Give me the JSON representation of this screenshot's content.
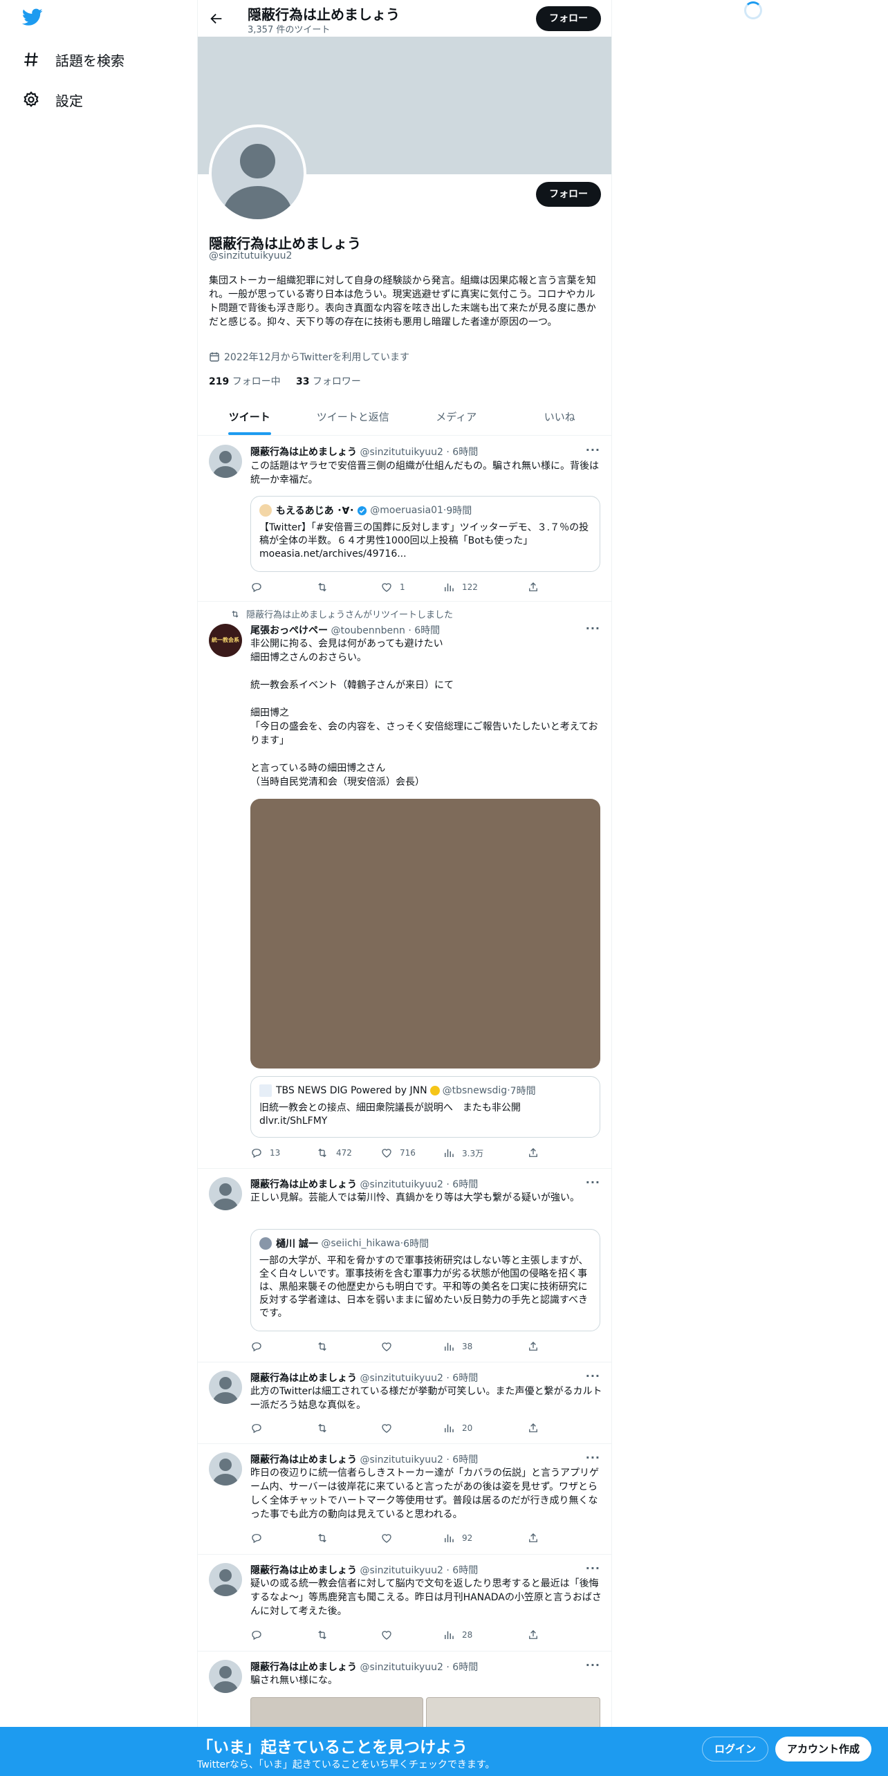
{
  "nav": {
    "search_label": "話題を検索",
    "settings_label": "設定",
    "logo": "twitter-bird-icon"
  },
  "header": {
    "title": "隠蔽行為は止めましょう",
    "tweet_count": "3,357 件のツイート",
    "follow_label": "フォロー"
  },
  "profile": {
    "name": "隠蔽行為は止めましょう",
    "handle": "@sinzitutuikyuu2",
    "bio": "集団ストーカー組織犯罪に対して自身の経験談から発言。組織は因果応報と言う言葉を知れ。一般が思っている寄り日本は危うい。現実逃避せずに真実に気付こう。コロナやカルト問題で背後も浮き彫り。表向き真面な内容を呟き出した末端も出て来たが見る度に愚かだと感じる。抑々、天下り等の存在に技術も悪用し暗躍した者達が原因の一つ。",
    "joined": "2022年12月からTwitterを利用しています",
    "following_count": "219",
    "following_label": "フォロー中",
    "followers_count": "33",
    "followers_label": "フォロワー",
    "follow_label": "フォロー"
  },
  "tabs": [
    "ツイート",
    "ツイートと返信",
    "メディア",
    "いいね"
  ],
  "tweets": [
    {
      "name": "隠蔽行為は止めましょう",
      "handle": "@sinzitutuikyuu2",
      "time": "6時間",
      "text": "この話題はヤラセで安倍晋三側の組織が仕組んだもの。騙され無い様に。背後は統一か幸福だ。",
      "quote": {
        "name": "もえるあじあ ･∀･",
        "handle": "@moeruasia01",
        "time": "9時間",
        "text": "【Twitter】「#安倍晋三の国葬に反対します」ツイッターデモ、３.７％の投稿が全体の半数。６４才男性1000回以上投稿「Botも使った」\nmoeasia.net/archives/49716..."
      },
      "stats": {
        "reply": "",
        "retweet": "",
        "like": "1",
        "views": "122"
      }
    },
    {
      "retweeted_by": "隠蔽行為は止めましょうさんがリツイートしました",
      "name": "尾張おっぺけペー",
      "handle": "@toubennbenn",
      "time": "6時間",
      "text": "非公開に拘る、会見は何があっても避けたい\n細田博之さんのおさらい。\n\n統一教会系イベント（韓鶴子さんが来日）にて\n\n細田博之\n「今日の盛会を、会の内容を、さっそく安倍総理にご報告いたしたいと考えております」\n\nと言っている時の細田博之さん\n（当時自民党清和会（現安倍派）会長）",
      "quote": {
        "name": "TBS NEWS DIG Powered by JNN",
        "handle": "@tbsnewsdig",
        "time": "7時間",
        "text": "旧統一教会との接点、細田衆院議長が説明へ　またも非公開\ndlvr.it/ShLFMY"
      },
      "avatar_text": "統一教会系",
      "stats": {
        "reply": "13",
        "retweet": "472",
        "like": "716",
        "views": "3.3万"
      }
    },
    {
      "name": "隠蔽行為は止めましょう",
      "handle": "@sinzitutuikyuu2",
      "time": "6時間",
      "text": "正しい見解。芸能人では菊川怜、真鍋かをり等は大学も繋がる疑いが強い。",
      "quote": {
        "name": "樋川 誠一",
        "handle": "@seiichi_hikawa",
        "time": "6時間",
        "text": "一部の大学が、平和を脅かすので軍事技術研究はしない等と主張しますが、全く白々しいです。軍事技術を含む軍事力が劣る状態が他国の侵略を招く事は、黒船来襲その他歴史からも明白です。平和等の美名を口実に技術研究に反対する学者達は、日本を弱いままに留めたい反日勢力の手先と認識すべきです。"
      },
      "stats": {
        "reply": "",
        "retweet": "",
        "like": "",
        "views": "38"
      }
    },
    {
      "name": "隠蔽行為は止めましょう",
      "handle": "@sinzitutuikyuu2",
      "time": "6時間",
      "text": "此方のTwitterは細工されている様だが挙動が可笑しい。また声優と繋がるカルト一派だろう姑息な真似を。",
      "stats": {
        "reply": "",
        "retweet": "",
        "like": "",
        "views": "20"
      }
    },
    {
      "name": "隠蔽行為は止めましょう",
      "handle": "@sinzitutuikyuu2",
      "time": "6時間",
      "text": "昨日の夜辺りに統一信者らしきストーカー達が「カバラの伝説」と言うアプリゲーム内、サーバーは彼岸花に来ていると言ったがあの後は姿を見せず。ワザとらしく全体チャットでハートマーク等使用せず。普段は居るのだが行き成り無くなった事でも此方の動向は見えていると思われる。",
      "stats": {
        "reply": "",
        "retweet": "",
        "like": "",
        "views": "92"
      }
    },
    {
      "name": "隠蔽行為は止めましょう",
      "handle": "@sinzitutuikyuu2",
      "time": "6時間",
      "text": "疑いの或る統一教会信者に対して脳内で文句を返したり思考すると最近は「後悔するなよ〜」等馬鹿発言も聞こえる。昨日は月刊HANADAの小笠原と言うおばさんに対して考えた後。",
      "stats": {
        "reply": "",
        "retweet": "",
        "like": "",
        "views": "28"
      }
    },
    {
      "name": "隠蔽行為は止めましょう",
      "handle": "@sinzitutuikyuu2",
      "time": "6時間",
      "text": "騙され無い様にな。"
    }
  ],
  "bottom_bar": {
    "title": "「いま」起きていることを見つけよう",
    "subtitle": "Twitterなら、「いま」起きていることをいち早くチェックできます。",
    "login": "ログイン",
    "signup": "アカウント作成"
  },
  "colors": {
    "accent": "#1d9bf0",
    "banner": "#cfd9de",
    "text": "#0f1419",
    "secondary": "#536471"
  }
}
